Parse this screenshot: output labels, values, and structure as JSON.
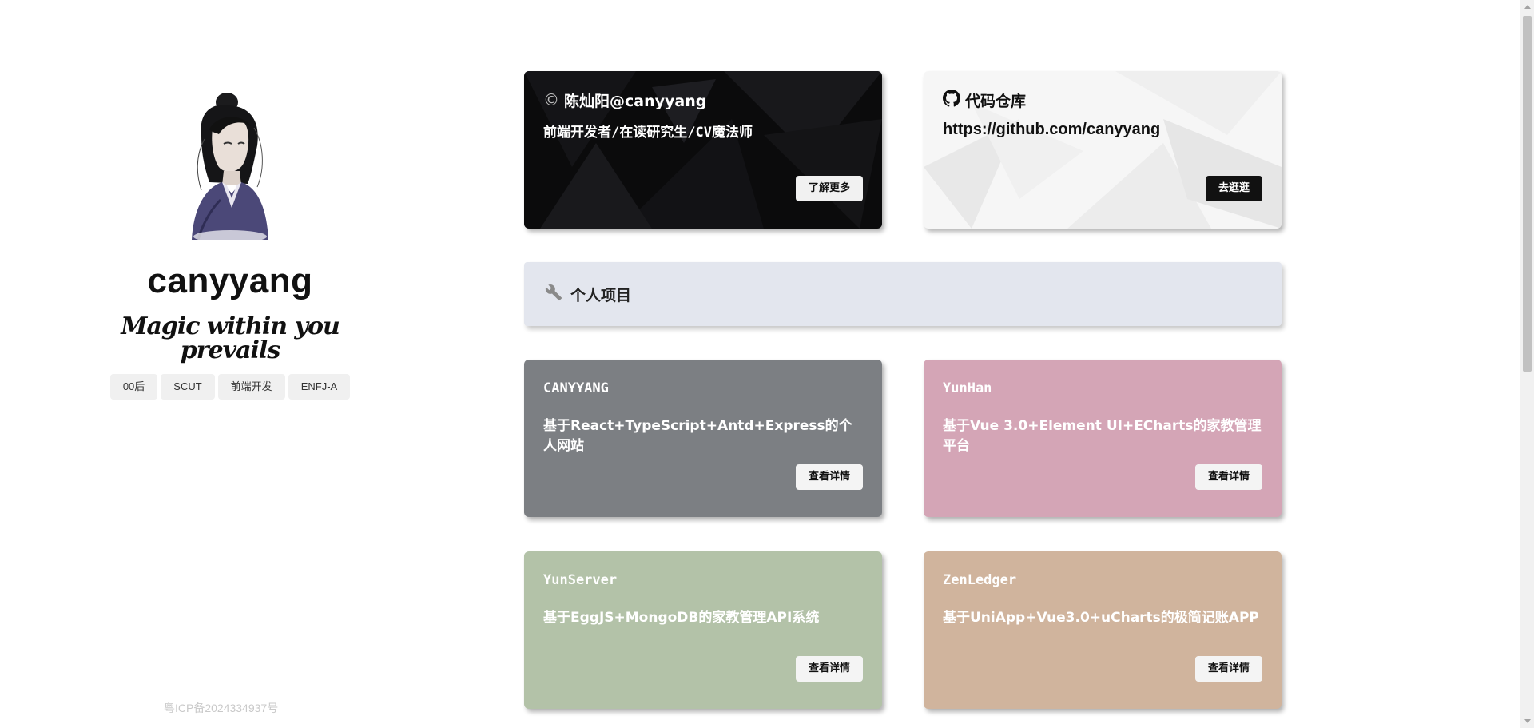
{
  "profile": {
    "username": "canyyang",
    "motto": "Magic within you prevails",
    "tags": [
      "00后",
      "SCUT",
      "前端开发",
      "ENFJ-A"
    ]
  },
  "footer": {
    "icp": "粤ICP备2024334937号"
  },
  "cards": {
    "profile_card": {
      "icon": "copyright-c-icon",
      "title": "陈灿阳@canyyang",
      "desc": "前端开发者/在读研究生/CV魔法师",
      "button": "了解更多"
    },
    "repo_card": {
      "icon": "github-icon",
      "title": "代码仓库",
      "desc": "https://github.com/canyyang",
      "button": "去逛逛"
    }
  },
  "section": {
    "icon": "wrench-icon",
    "title": "个人项目"
  },
  "projects": [
    {
      "name": "CANYYANG",
      "desc": "基于React+TypeScript+Antd+Express的个人网站",
      "button": "查看详情",
      "color": "#7c7f83"
    },
    {
      "name": "YunHan",
      "desc": "基于Vue 3.0+Element UI+ECharts的家教管理平台",
      "button": "查看详情",
      "color": "#d4a5b6"
    },
    {
      "name": "YunServer",
      "desc": "基于EggJS+MongoDB的家教管理API系统",
      "button": "查看详情",
      "color": "#b3c2a8"
    },
    {
      "name": "ZenLedger",
      "desc": "基于UniApp+Vue3.0+uCharts的极简记账APP",
      "button": "查看详情",
      "color": "#d0b49d"
    }
  ]
}
